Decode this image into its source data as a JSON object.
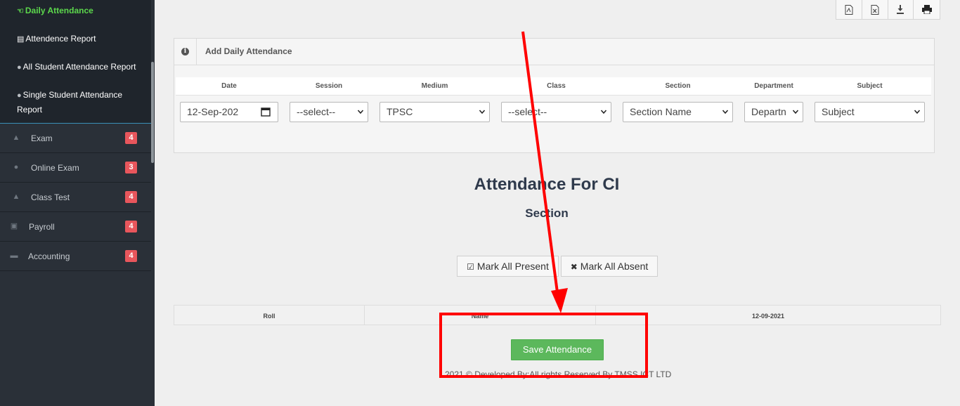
{
  "sidebar": {
    "submenu": [
      {
        "label": "Daily Attendance",
        "icon": "hand-icon",
        "active": true
      },
      {
        "label": "Attendence Report",
        "icon": "document-icon"
      },
      {
        "label": "All Student Attendance Report",
        "icon": "circle-icon"
      },
      {
        "label": "Single Student Attendance Report",
        "icon": "circle-icon"
      }
    ],
    "items": [
      {
        "label": "Exam",
        "badge": "4",
        "icon": "graduation-cap-icon"
      },
      {
        "label": "Online Exam",
        "badge": "3",
        "icon": "info-icon"
      },
      {
        "label": "Class Test",
        "badge": "4",
        "icon": "graduation-cap-icon"
      },
      {
        "label": "Payroll",
        "badge": "4",
        "icon": "money-icon"
      },
      {
        "label": "Accounting",
        "badge": "4",
        "icon": "briefcase-icon"
      }
    ]
  },
  "toolbar": {
    "buttons": [
      "pdf-icon",
      "excel-icon",
      "download-icon",
      "print-icon"
    ]
  },
  "panel": {
    "title": "Add Daily Attendance",
    "columns": {
      "date": "Date",
      "session": "Session",
      "medium": "Medium",
      "class": "Class",
      "section": "Section",
      "department": "Department",
      "subject": "Subject"
    },
    "fields": {
      "date": "12-Sep-202",
      "session": "--select--",
      "medium": "TPSC",
      "class": "--select--",
      "section": "Section Name",
      "department": "Departn",
      "subject": "Subject"
    }
  },
  "main": {
    "heading": "Attendance For CI",
    "subheading": "Section",
    "mark_all_present": "Mark All Present",
    "mark_all_absent": "Mark All Absent",
    "table_headers": [
      "Roll",
      "Name",
      "12-09-2021"
    ],
    "save_button": "Save Attendance",
    "footer": "2021 © Developed By:All rights Reserved By TMSS ICT LTD"
  },
  "colors": {
    "sidebar_bg": "#2a3038",
    "active_menu": "#5cd84c",
    "badge": "#e8565c",
    "save_button": "#5cb85c",
    "annotation": "#ff0000"
  }
}
